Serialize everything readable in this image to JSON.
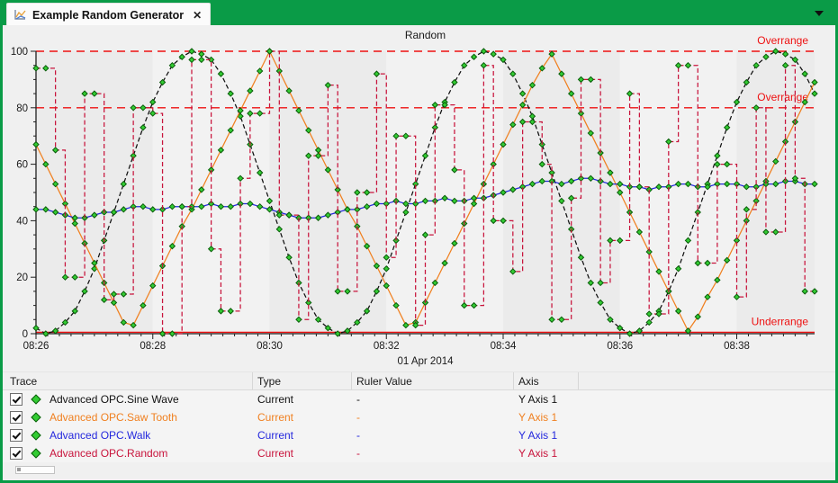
{
  "tab_bar": {
    "tab_title": "Example Random Generator",
    "icons": {
      "close": "✕",
      "dropdown": "▼"
    }
  },
  "colors": {
    "frame_green": "#0a9b47",
    "panel_bg": "#f0f0f0",
    "band_dark": "#ebebeb",
    "band_light": "#f2f2f2",
    "axis": "#202020",
    "limit_red": "#ee1111",
    "marker_fill": "#33cc33",
    "marker_stroke": "#0a5c0a"
  },
  "chart_data": {
    "type": "line",
    "title": "Random",
    "date_label": "01 Apr 2014",
    "x_start_label": "08:26",
    "sample_interval_seconds": 10,
    "x_axis_labels": [
      "08:26",
      "08:28",
      "08:30",
      "08:32",
      "08:34",
      "08:36",
      "08:38"
    ],
    "y_ticks": [
      0,
      20,
      40,
      60,
      80,
      100
    ],
    "ylim": [
      0,
      100
    ],
    "grid": false,
    "legend_position": "table-below",
    "limit_lines": [
      {
        "label": "Overrange",
        "value": 100,
        "style": "dashed"
      },
      {
        "label": "Overrange",
        "value": 80,
        "style": "dashed"
      },
      {
        "label": "Underrange",
        "value": 0.5,
        "style": "solid"
      }
    ],
    "series": [
      {
        "name": "Advanced OPC.Sine Wave",
        "color": "#111111",
        "line_style": "dashed",
        "step": false,
        "values": [
          2,
          0,
          1,
          4,
          8,
          15,
          23,
          33,
          43,
          53,
          63,
          73,
          82,
          89,
          95,
          98,
          100,
          99,
          97,
          92,
          85,
          77,
          67,
          57,
          47,
          37,
          27,
          18,
          11,
          5,
          2,
          0,
          1,
          4,
          8,
          15,
          23,
          33,
          43,
          53,
          63,
          73,
          82,
          89,
          95,
          98,
          100,
          99,
          97,
          92,
          85,
          77,
          67,
          57,
          47,
          37,
          27,
          18,
          11,
          5,
          2,
          0,
          1,
          4,
          8,
          15,
          23,
          33,
          43,
          53,
          63,
          73,
          82,
          89,
          95,
          98,
          100,
          99,
          97,
          92,
          85
        ]
      },
      {
        "name": "Advanced OPC.Saw Tooth",
        "color": "#f08020",
        "line_style": "solid",
        "step": false,
        "values": [
          67,
          60,
          53,
          46,
          39,
          32,
          25,
          18,
          11,
          4,
          3,
          10,
          17,
          24,
          31,
          38,
          44,
          51,
          58,
          65,
          72,
          79,
          86,
          93,
          100,
          93,
          86,
          79,
          72,
          65,
          58,
          51,
          44,
          38,
          31,
          24,
          17,
          10,
          3,
          4,
          11,
          18,
          25,
          32,
          39,
          46,
          53,
          60,
          67,
          74,
          81,
          88,
          94,
          99,
          92,
          85,
          78,
          71,
          64,
          57,
          50,
          43,
          36,
          29,
          22,
          15,
          8,
          1,
          6,
          13,
          19,
          26,
          33,
          40,
          47,
          54,
          61,
          68,
          75,
          82,
          89
        ]
      },
      {
        "name": "Advanced OPC.Walk",
        "color": "#2428dd",
        "line_style": "solid",
        "step": false,
        "values": [
          44,
          44,
          43,
          42,
          41,
          41,
          42,
          43,
          43,
          44,
          45,
          45,
          44,
          44,
          45,
          45,
          45,
          45,
          46,
          45,
          45,
          46,
          46,
          45,
          44,
          43,
          42,
          41,
          41,
          41,
          42,
          43,
          44,
          44,
          45,
          46,
          46,
          47,
          46,
          46,
          47,
          47,
          48,
          47,
          47,
          48,
          48,
          49,
          50,
          51,
          52,
          53,
          54,
          54,
          53,
          54,
          55,
          55,
          54,
          53,
          53,
          52,
          52,
          51,
          52,
          52,
          53,
          53,
          52,
          52,
          53,
          53,
          53,
          52,
          52,
          53,
          53,
          54,
          54,
          53,
          53
        ]
      },
      {
        "name": "Advanced OPC.Random",
        "color": "#c8143c",
        "line_style": "dashed",
        "step": true,
        "values": [
          94,
          94,
          65,
          20,
          20,
          85,
          85,
          12,
          14,
          14,
          80,
          80,
          78,
          0,
          0,
          45,
          97,
          97,
          30,
          8,
          8,
          55,
          78,
          78,
          100,
          42,
          42,
          5,
          63,
          63,
          88,
          15,
          15,
          50,
          50,
          92,
          27,
          70,
          70,
          3,
          35,
          81,
          81,
          58,
          10,
          10,
          95,
          40,
          40,
          22,
          75,
          75,
          60,
          5,
          5,
          48,
          90,
          90,
          18,
          33,
          33,
          85,
          52,
          7,
          7,
          68,
          95,
          95,
          25,
          25,
          60,
          60,
          13,
          44,
          80,
          36,
          36,
          95,
          55,
          15,
          15
        ]
      }
    ],
    "marker": {
      "shape": "diamond",
      "fill": "#33cc33",
      "stroke": "#0a5c0a"
    }
  },
  "table": {
    "columns": [
      {
        "label": "Trace"
      },
      {
        "label": "Type"
      },
      {
        "label": "Ruler Value"
      },
      {
        "label": "Axis"
      }
    ],
    "rows": [
      {
        "checked": true,
        "trace": "Advanced OPC.Sine Wave",
        "type": "Current",
        "ruler_value": "-",
        "axis": "Y Axis 1",
        "color": "#111111"
      },
      {
        "checked": true,
        "trace": "Advanced OPC.Saw Tooth",
        "type": "Current",
        "ruler_value": "-",
        "axis": "Y Axis 1",
        "color": "#f08020"
      },
      {
        "checked": true,
        "trace": "Advanced OPC.Walk",
        "type": "Current",
        "ruler_value": "-",
        "axis": "Y Axis 1",
        "color": "#2428dd"
      },
      {
        "checked": true,
        "trace": "Advanced OPC.Random",
        "type": "Current",
        "ruler_value": "-",
        "axis": "Y Axis 1",
        "color": "#c8143c"
      }
    ]
  }
}
